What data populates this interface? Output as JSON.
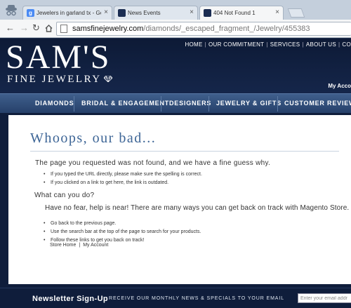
{
  "browser": {
    "tabs": [
      {
        "title": "Jewelers in garland tx - Go",
        "favicon": "google-icon",
        "color": "#4a8af4"
      },
      {
        "title": "News Events",
        "favicon": "sams-icon",
        "color": "#1b2d52"
      },
      {
        "title": "404 Not Found 1",
        "favicon": "sams-icon",
        "color": "#1b2d52"
      }
    ],
    "url_host": "samsfinejewelry.com",
    "url_path": "/diamonds/_escaped_fragment_/Jewelry/455383"
  },
  "header": {
    "logo_main": "SAM'S",
    "logo_sub": "FINE JEWELRY",
    "top_links": [
      "HOME",
      "OUR COMMITMENT",
      "SERVICES",
      "ABOUT US",
      "CO"
    ],
    "my_account": "My Acco"
  },
  "nav": [
    "DIAMONDS",
    "BRIDAL & ENGAGEMENT",
    "DESIGNERS",
    "JEWELRY & GIFTS",
    "CUSTOMER REVIEWS"
  ],
  "content": {
    "title": "Whoops, our bad...",
    "main_text": "The page you requested was not found, and we have a fine guess why.",
    "reasons": [
      "If you typed the URL directly, please make sure the spelling is correct.",
      "If you clicked on a link to get here, the link is outdated."
    ],
    "subtitle": "What can you do?",
    "help_text": "Have no fear, help is near! There are many ways you can get back on track with Magento Store.",
    "actions": [
      "Go back to the previous page.",
      "Use the search bar at the top of the page to search for your products.",
      "Follow these links to get you back on track!"
    ],
    "links": [
      "Store Home",
      "My Account"
    ],
    "links_sep": "|"
  },
  "footer": {
    "newsletter_title": "Newsletter Sign-Up",
    "newsletter_text": "RECEIVE OUR MONTHLY NEWS & SPECIALS TO YOUR EMAIL",
    "email_placeholder": "Enter your email addr"
  }
}
